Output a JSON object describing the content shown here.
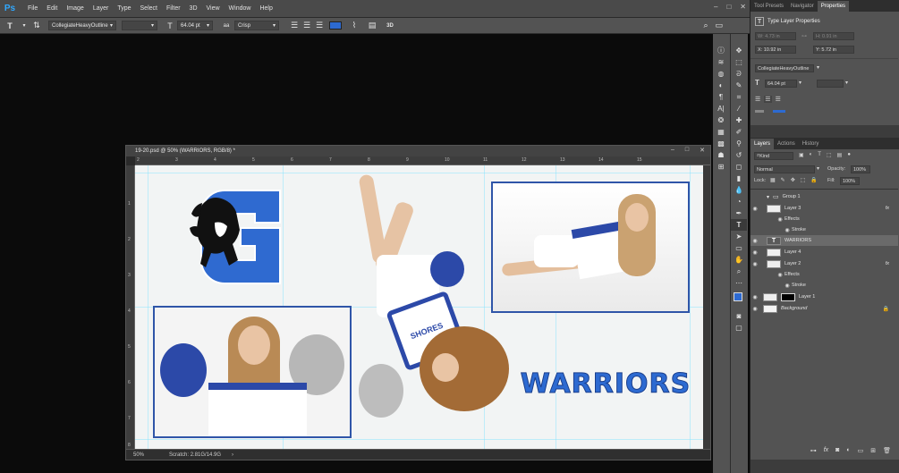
{
  "app": {
    "logo": "Ps",
    "menu": [
      "File",
      "Edit",
      "Image",
      "Layer",
      "Type",
      "Select",
      "Filter",
      "3D",
      "View",
      "Window",
      "Help"
    ]
  },
  "options_bar": {
    "font_family": "CollegiateHeavyOutline",
    "font_size": "64.04 pt",
    "antialias": "Crisp",
    "text_color": "#2d6ad1",
    "three_d": "3D"
  },
  "document": {
    "title": "19-20.psd @ 50% (WARRIORS, RGB/8) *",
    "zoom": "50%",
    "scratch": "Scratch: 2.81G/14.9G",
    "ruler_top": [
      "2",
      "3",
      "4",
      "5",
      "6",
      "7",
      "8",
      "9",
      "10",
      "11",
      "12",
      "13",
      "14",
      "15"
    ],
    "ruler_left": [
      "1",
      "2",
      "3",
      "4",
      "5",
      "6",
      "7",
      "8"
    ],
    "canvas_text": "WARRIORS",
    "jersey_text": "SHORES"
  },
  "right_panel": {
    "tabs_top": [
      "Tool Presets",
      "Navigator",
      "Properties"
    ],
    "properties_title": "Type Layer Properties",
    "w": "W: 4.73 in",
    "h": "H: 0.91 in",
    "x": "X: 10.92 in",
    "y": "Y: 5.72 in",
    "font_family": "CollegiateHeavyOutline",
    "font_size": "64.04 pt",
    "tabs_layers": [
      "Layers",
      "Actions",
      "History"
    ],
    "kind": "Kind",
    "blend_mode": "Normal",
    "opacity_label": "Opacity:",
    "opacity_value": "100%",
    "lock_label": "Lock:",
    "fill_label": "Fill:",
    "fill_value": "100%",
    "layers": [
      {
        "name": "Group 1",
        "indent": 0,
        "type": "group"
      },
      {
        "name": "Layer 3",
        "indent": 1,
        "type": "layer",
        "fx": "fx"
      },
      {
        "name": "Effects",
        "indent": 2,
        "type": "effect"
      },
      {
        "name": "Stroke",
        "indent": 3,
        "type": "effect"
      },
      {
        "name": "WARRIORS",
        "indent": 1,
        "type": "text",
        "selected": true
      },
      {
        "name": "Layer 4",
        "indent": 1,
        "type": "layer"
      },
      {
        "name": "Layer 2",
        "indent": 1,
        "type": "layer",
        "fx": "fx"
      },
      {
        "name": "Effects",
        "indent": 2,
        "type": "effect"
      },
      {
        "name": "Stroke",
        "indent": 3,
        "type": "effect"
      },
      {
        "name": "Layer 1",
        "indent": 0,
        "type": "masked"
      },
      {
        "name": "Background",
        "indent": 0,
        "type": "background"
      }
    ]
  },
  "colors": {
    "accent_blue": "#2f55a8",
    "warriors_blue": "#2d6ad1"
  }
}
